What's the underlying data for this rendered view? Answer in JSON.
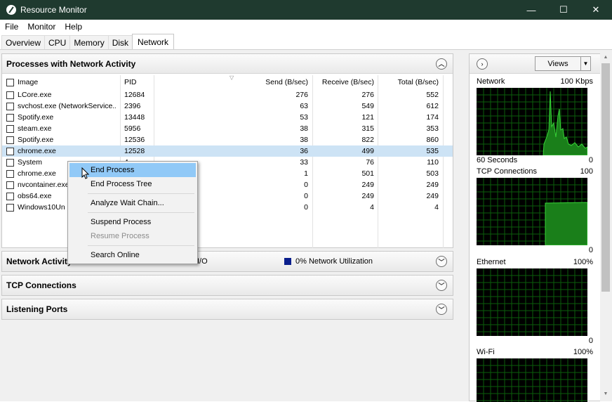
{
  "window": {
    "title": "Resource Monitor",
    "minimize": "—",
    "maximize": "☐",
    "close": "✕"
  },
  "menu": [
    "File",
    "Monitor",
    "Help"
  ],
  "tabs": [
    "Overview",
    "CPU",
    "Memory",
    "Disk",
    "Network"
  ],
  "active_tab": "Network",
  "processes_panel": {
    "title": "Processes with Network Activity",
    "columns": [
      "Image",
      "PID",
      "Send (B/sec)",
      "Receive (B/sec)",
      "Total (B/sec)"
    ],
    "rows": [
      {
        "image": "LCore.exe",
        "pid": "12684",
        "send": "276",
        "receive": "276",
        "total": "552"
      },
      {
        "image": "svchost.exe (NetworkService...",
        "pid": "2396",
        "send": "63",
        "receive": "549",
        "total": "612"
      },
      {
        "image": "Spotify.exe",
        "pid": "13448",
        "send": "53",
        "receive": "121",
        "total": "174"
      },
      {
        "image": "steam.exe",
        "pid": "5956",
        "send": "38",
        "receive": "315",
        "total": "353"
      },
      {
        "image": "Spotify.exe",
        "pid": "12536",
        "send": "38",
        "receive": "822",
        "total": "860"
      },
      {
        "image": "chrome.exe",
        "pid": "12528",
        "send": "36",
        "receive": "499",
        "total": "535"
      },
      {
        "image": "System",
        "pid": "4",
        "send": "33",
        "receive": "76",
        "total": "110"
      },
      {
        "image": "chrome.exe",
        "pid": "",
        "send": "1",
        "receive": "501",
        "total": "503"
      },
      {
        "image": "nvcontainer.exe",
        "pid": "",
        "send": "0",
        "receive": "249",
        "total": "249"
      },
      {
        "image": "obs64.exe",
        "pid": "",
        "send": "0",
        "receive": "249",
        "total": "249"
      },
      {
        "image": "Windows10Un",
        "pid": "",
        "send": "0",
        "receive": "4",
        "total": "4"
      }
    ],
    "selected_row": 5
  },
  "network_activity_panel": {
    "title": "Network Activity",
    "io_text": "I/O",
    "utilization": "0% Network Utilization"
  },
  "tcp_panel": {
    "title": "TCP Connections"
  },
  "listening_panel": {
    "title": "Listening Ports"
  },
  "context_menu": {
    "items": [
      {
        "label": "End Process",
        "state": "hover"
      },
      {
        "label": "End Process Tree",
        "state": "normal"
      },
      {
        "label": "Analyze Wait Chain...",
        "state": "normal"
      },
      {
        "label": "Suspend Process",
        "state": "normal"
      },
      {
        "label": "Resume Process",
        "state": "disabled"
      },
      {
        "label": "Search Online",
        "state": "normal"
      }
    ]
  },
  "right_panel": {
    "views_label": "Views",
    "graphs": [
      {
        "title": "Network",
        "max": "100 Kbps",
        "footer_left": "60 Seconds",
        "footer_right": "0"
      },
      {
        "title": "TCP Connections",
        "max": "100",
        "footer_left": "",
        "footer_right": "0"
      },
      {
        "title": "Ethernet",
        "max": "100%",
        "footer_left": "",
        "footer_right": "0"
      },
      {
        "title": "Wi-Fi",
        "max": "100%",
        "footer_left": "",
        "footer_right": ""
      }
    ]
  },
  "colors": {
    "titlebar": "#1f3a2f",
    "graph_bg": "#000000",
    "graph_grid": "#0b6b0b",
    "graph_line": "#22c322",
    "selection": "#cde3f5",
    "menu_hover": "#91c9f7"
  }
}
